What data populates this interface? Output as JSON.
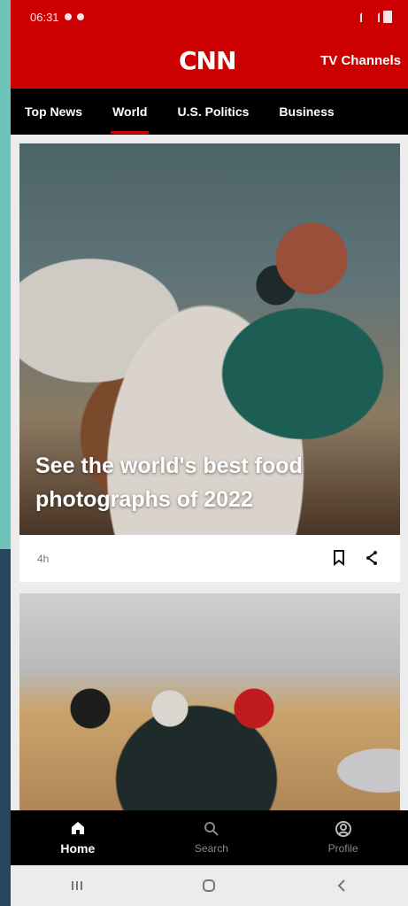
{
  "status_bar": {
    "time": "06:31"
  },
  "header": {
    "logo": "CNN",
    "tv_channels": "TV Channels"
  },
  "tabs": [
    {
      "label": "Top News",
      "active": false
    },
    {
      "label": "World",
      "active": true
    },
    {
      "label": "U.S. Politics",
      "active": false
    },
    {
      "label": "Business",
      "active": false
    }
  ],
  "card1": {
    "headline": "See the world's best food photographs of 2022",
    "time": "4h"
  },
  "bottom_nav": {
    "home": "Home",
    "search": "Search",
    "profile": "Profile"
  },
  "colors": {
    "brand_red": "#cc0000",
    "nav_black": "#000000"
  }
}
